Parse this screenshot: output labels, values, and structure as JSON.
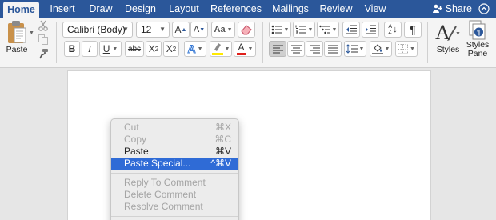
{
  "tabs": [
    {
      "label": "Home",
      "active": true
    },
    {
      "label": "Insert"
    },
    {
      "label": "Draw"
    },
    {
      "label": "Design"
    },
    {
      "label": "Layout"
    },
    {
      "label": "References"
    },
    {
      "label": "Mailings"
    },
    {
      "label": "Review"
    },
    {
      "label": "View"
    }
  ],
  "share_label": "Share",
  "ribbon": {
    "paste_label": "Paste",
    "font_name": "Calibri (Body)",
    "font_size": "12",
    "grow_font": "A",
    "shrink_font": "A",
    "change_case": "Aa",
    "bold": "B",
    "italic": "I",
    "underline": "U",
    "strikethrough": "abc",
    "subscript": "X",
    "subscript_mark": "2",
    "superscript": "X",
    "superscript_mark": "2",
    "text_effects": "A",
    "highlight": "ab",
    "font_color": "A",
    "sort_icon_top": "A",
    "sort_icon_bottom": "Z",
    "pilcrow": "¶",
    "styles_label": "Styles",
    "styles_pane_label_1": "Styles",
    "styles_pane_label_2": "Pane",
    "styles_glyph": "A"
  },
  "context_menu": {
    "groups": [
      [
        {
          "label": "Cut",
          "shortcut": "⌘X",
          "enabled": false
        },
        {
          "label": "Copy",
          "shortcut": "⌘C",
          "enabled": false
        },
        {
          "label": "Paste",
          "shortcut": "⌘V",
          "enabled": true
        },
        {
          "label": "Paste Special...",
          "shortcut": "^⌘V",
          "enabled": true,
          "highlighted": true
        }
      ],
      [
        {
          "label": "Reply To Comment",
          "enabled": false
        },
        {
          "label": "Delete Comment",
          "enabled": false
        },
        {
          "label": "Resolve Comment",
          "enabled": false
        }
      ]
    ]
  },
  "colors": {
    "tab_bar": "#2b579a",
    "menu_highlight": "#2f6bd6",
    "highlight_swatch": "#ffe900",
    "font_color_swatch": "#e0201b"
  }
}
